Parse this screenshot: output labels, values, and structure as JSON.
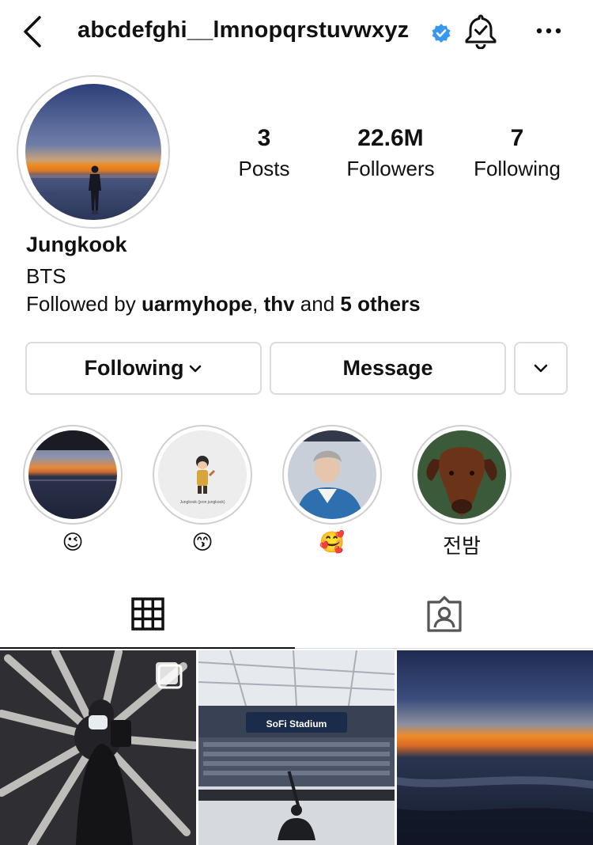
{
  "header": {
    "username": "abcdefghi__lmnopqrstuvwxyz",
    "verified": true,
    "icons": [
      "chevron-left-icon",
      "verified-badge-icon",
      "bell-check-icon",
      "more-horizontal-icon"
    ]
  },
  "profile": {
    "stats": [
      {
        "value": "3",
        "label": "Posts"
      },
      {
        "value": "22.6M",
        "label": "Followers"
      },
      {
        "value": "7",
        "label": "Following"
      }
    ],
    "name": "Jungkook",
    "bio": "BTS",
    "followed_by": {
      "prefix": "Followed by ",
      "user1": "uarmyhope",
      "sep": ", ",
      "user2": "thv",
      "and": " and ",
      "others": "5 others"
    }
  },
  "actions": {
    "following_label": "Following",
    "message_label": "Message"
  },
  "highlights": [
    {
      "label": "😉"
    },
    {
      "label": "😙"
    },
    {
      "label": "🥰"
    },
    {
      "label": "전밤"
    }
  ],
  "highlight_sticker_text": "Jungkook (jeon jungkook)",
  "grid_stadium_sign": "SoFi Stadium",
  "tabs": [
    "grid-icon",
    "tagged-icon"
  ],
  "colors": {
    "accent_blue": "#3897f0",
    "border": "#dbdbdb",
    "text": "#111111"
  }
}
